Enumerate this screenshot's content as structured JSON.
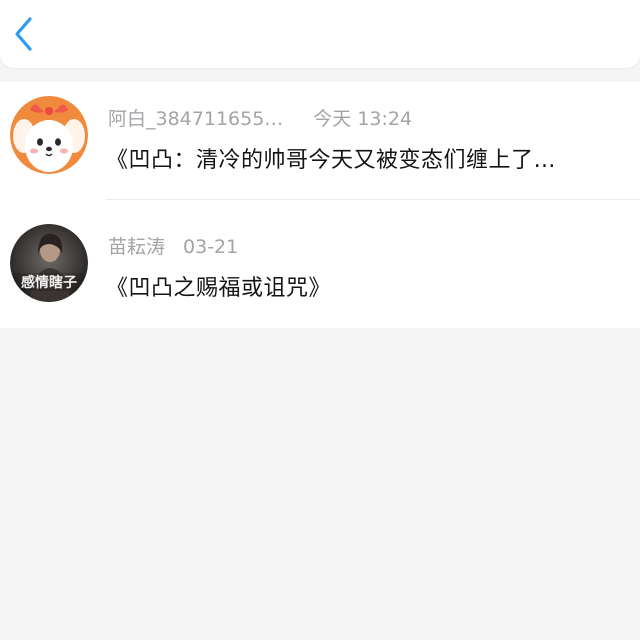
{
  "header": {
    "back_icon": "chevron-left-icon",
    "accent_color": "#2b9bf4"
  },
  "messages": [
    {
      "sender": "阿白_384711655…",
      "time": "今天 13:24",
      "text": "《凹凸：清冷的帅哥今天又被变态们缠上了…",
      "avatar_icon": "cartoon-dog-avatar"
    },
    {
      "sender": "苗耘涛",
      "time": "03-21",
      "text": "《凹凸之赐福或诅咒》",
      "avatar_icon": "photo-avatar",
      "avatar_caption": "感情瞎子"
    }
  ]
}
